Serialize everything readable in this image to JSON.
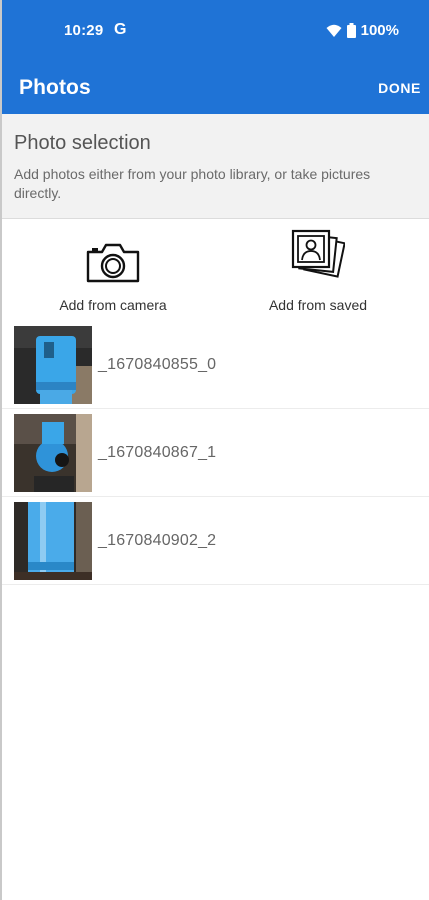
{
  "status_bar": {
    "time": "10:29",
    "g_letter": "G",
    "battery": "100%"
  },
  "app_bar": {
    "title": "Photos",
    "done_label": "DONE"
  },
  "section": {
    "title": "Photo selection",
    "description": "Add photos either from your photo library, or take pictures directly."
  },
  "actions": {
    "camera_label": "Add from camera",
    "saved_label": "Add from saved"
  },
  "photos": [
    {
      "name": "_1670840855_0"
    },
    {
      "name": "_1670840867_1"
    },
    {
      "name": "_1670840902_2"
    }
  ],
  "colors": {
    "app_bar": "#1f73d6",
    "header_bg": "#f2f2f2",
    "thumb_blue": "#3aa6e8"
  }
}
